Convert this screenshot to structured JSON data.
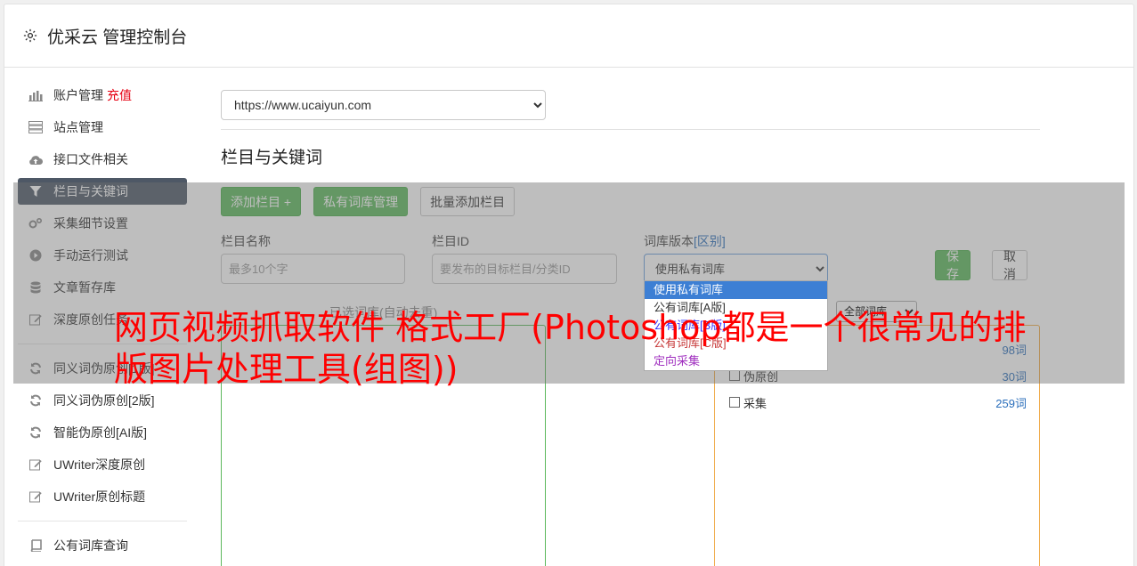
{
  "header": {
    "title": "优采云 管理控制台"
  },
  "sidebar": {
    "items": [
      {
        "label": "账户管理",
        "badge": "充值",
        "icon": "bar-chart-icon"
      },
      {
        "label": "站点管理",
        "icon": "server-icon"
      },
      {
        "label": "接口文件相关",
        "icon": "cloud-upload-icon"
      },
      {
        "label": "栏目与关键词",
        "icon": "filter-icon",
        "active": true
      },
      {
        "label": "采集细节设置",
        "icon": "gears-icon"
      },
      {
        "label": "手动运行测试",
        "icon": "play-circle-icon"
      },
      {
        "label": "文章暂存库",
        "icon": "database-icon"
      },
      {
        "label": "深度原创任务",
        "icon": "edit-icon"
      }
    ],
    "items2": [
      {
        "label": "同义词伪原创[1版]",
        "icon": "refresh-icon"
      },
      {
        "label": "同义词伪原创[2版]",
        "icon": "refresh-icon"
      },
      {
        "label": "智能伪原创[AI版]",
        "icon": "refresh-icon"
      },
      {
        "label": "UWriter深度原创",
        "icon": "edit-icon"
      },
      {
        "label": "UWriter原创标题",
        "icon": "edit-icon"
      }
    ],
    "items3": [
      {
        "label": "公有词库查询",
        "icon": "book-icon"
      }
    ]
  },
  "main": {
    "site_select": "https://www.ucaiyun.com",
    "section_title": "栏目与关键词",
    "buttons": {
      "add_column": "添加栏目 +",
      "private_dict": "私有词库管理",
      "batch_add": "批量添加栏目"
    },
    "form": {
      "name_label": "栏目名称",
      "name_placeholder": "最多10个字",
      "id_label": "栏目ID",
      "id_placeholder": "要发布的目标栏目/分类ID",
      "version_label": "词库版本",
      "version_link": "[区别]",
      "version_value": "使用私有词库",
      "save": "保存",
      "cancel": "取消"
    },
    "version_options": [
      "使用私有词库",
      "公有词库[A版]",
      "公有词库[B版]",
      "公有词库[C版]",
      "定向采集"
    ],
    "selected_label": "已选词库(自动去重)",
    "dict_filter": "全部词库",
    "dicts": [
      {
        "label": "",
        "count": "98词"
      },
      {
        "label": "伪原创",
        "count": "30词"
      },
      {
        "label": "采集",
        "count": "259词"
      }
    ]
  },
  "overlay_text": "网页视频抓取软件 格式工厂(Photoshop都是一个很常见的排版图片处理工具(组图))",
  "colors": {
    "active_nav": "#4e5866",
    "green": "#5cb85c",
    "headline": "#ff0000",
    "recharge": "#e60012"
  }
}
